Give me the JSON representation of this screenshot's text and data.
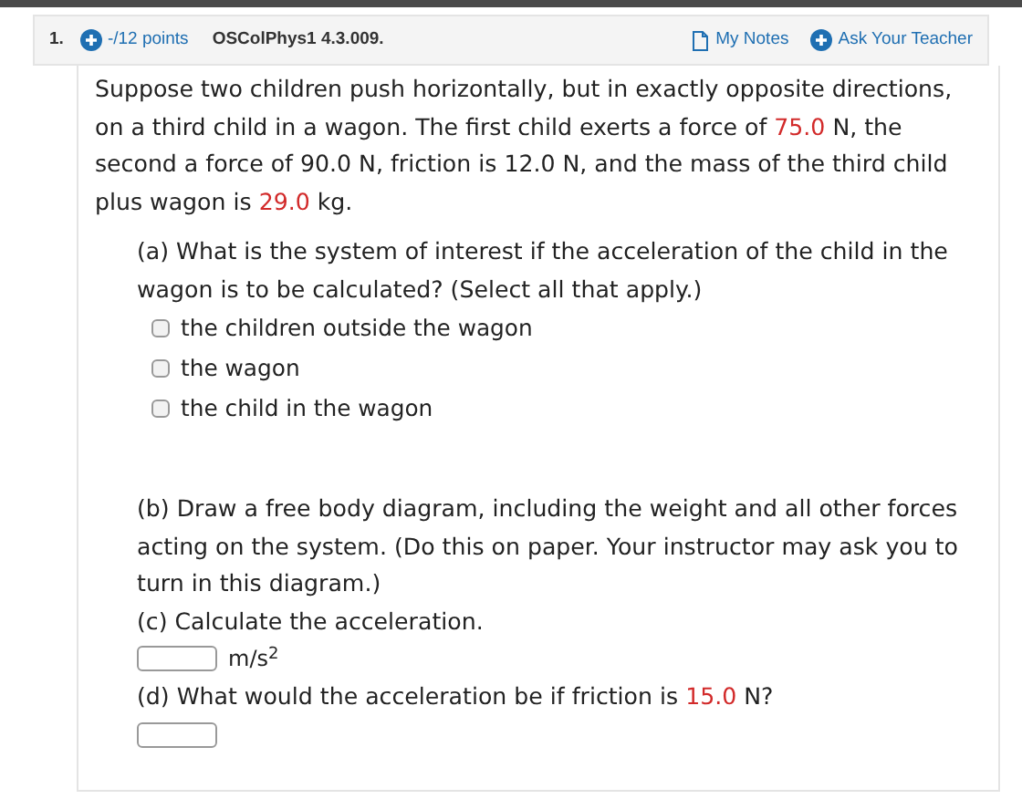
{
  "question": {
    "number": "1.",
    "points": "-/12 points",
    "source": "OSColPhys1 4.3.009.",
    "notes_link": "My Notes",
    "ask_link": "Ask Your Teacher"
  },
  "prompt": [
    {
      "text": "Suppose two children push horizontally, but in exactly opposite directions, on a third child in a wagon. The first child exerts a force of ",
      "highlight": false
    },
    {
      "text": "75.0",
      "highlight": true
    },
    {
      "text": " N, the second a force of 90.0 N, friction is 12.0 N, and the mass of the third child plus wagon is ",
      "highlight": false
    },
    {
      "text": "29.0",
      "highlight": true
    },
    {
      "text": " kg.",
      "highlight": false
    }
  ],
  "parts": [
    {
      "kind": "choice",
      "question": [
        {
          "text": "(a) What is the system of interest if the acceleration of the child in the wagon is to be calculated? (Select all that apply.)",
          "highlight": false
        }
      ],
      "options": [
        {
          "label": "the children outside the wagon",
          "checked": false
        },
        {
          "label": "the wagon",
          "checked": false
        },
        {
          "label": "the child in the wagon",
          "checked": false
        }
      ]
    },
    {
      "kind": "text",
      "question": [
        {
          "text": "(b) Draw a free body diagram, including the weight and all other forces acting on the system. (Do this on paper. Your instructor may ask you to turn in this diagram.)",
          "highlight": false
        }
      ]
    },
    {
      "kind": "answer",
      "question": [
        {
          "text": "(c) Calculate the acceleration.",
          "highlight": false
        }
      ],
      "unit": "m/s$^{2}$"
    },
    {
      "kind": "answer",
      "question": [
        {
          "text": "(d) What would the acceleration be if friction is ",
          "highlight": false
        },
        {
          "text": "15.0",
          "highlight": true
        },
        {
          "text": " N?",
          "highlight": false
        }
      ]
    }
  ]
}
